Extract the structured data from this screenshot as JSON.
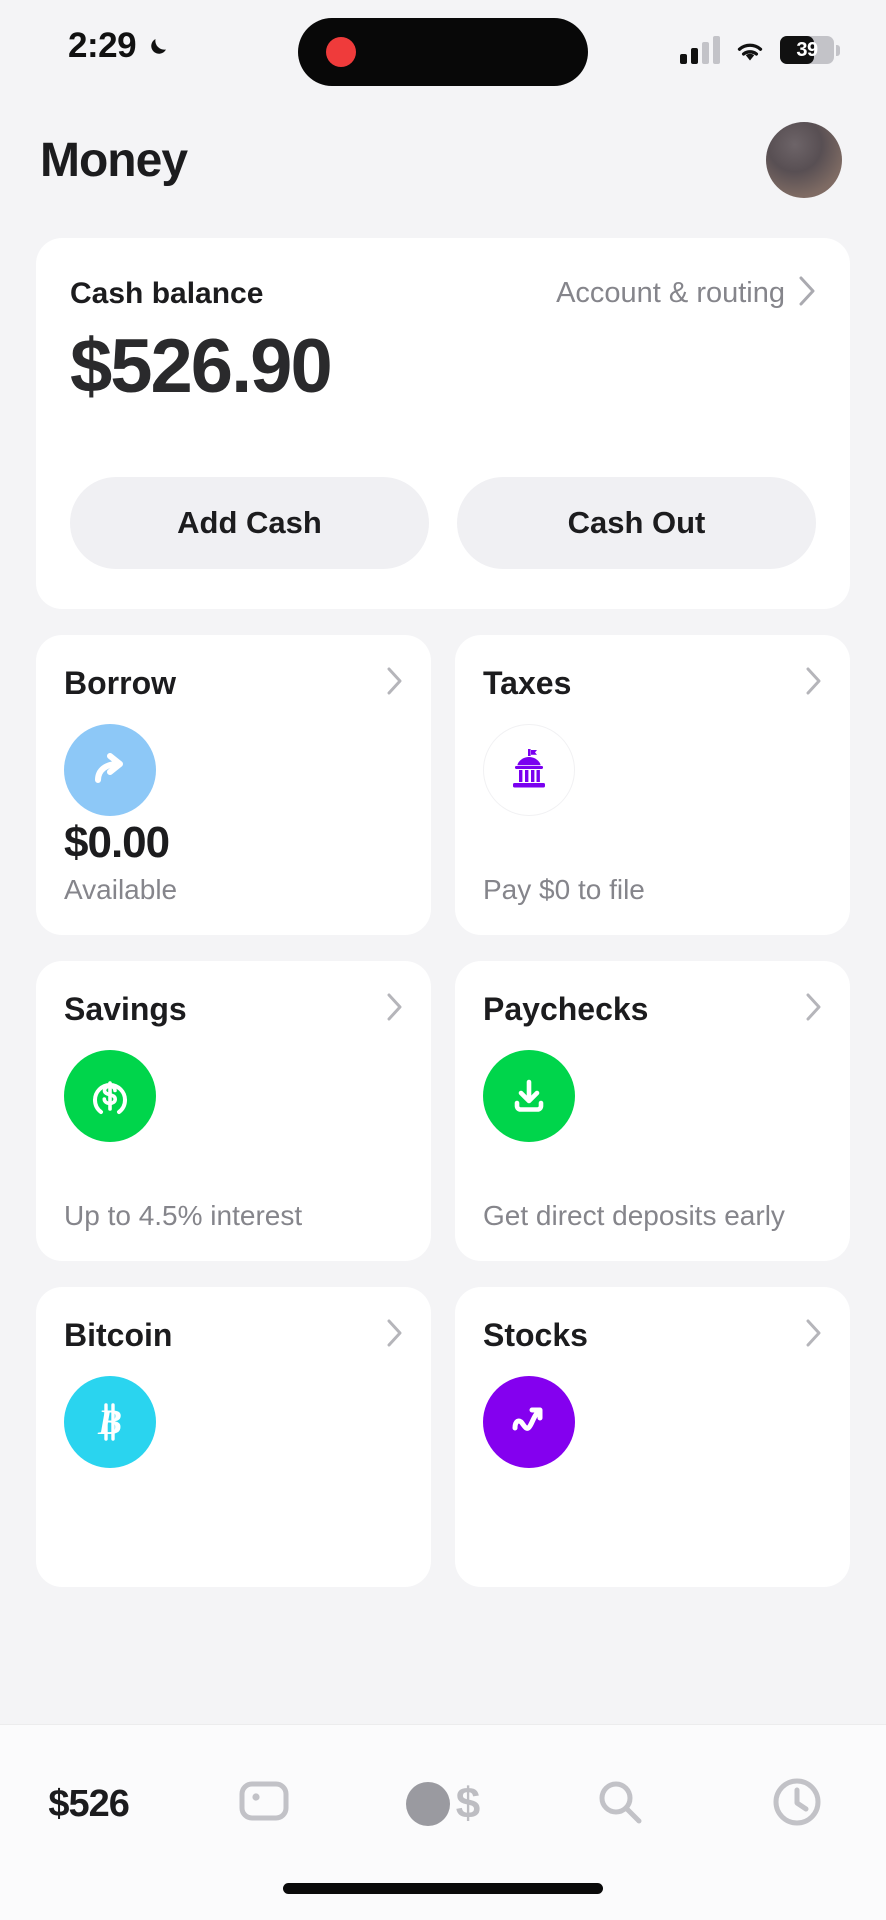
{
  "status_bar": {
    "time": "2:29",
    "dnd_icon": "moon-icon",
    "recording_icon": "record-dot-icon",
    "signal_icon": "cellular-signal-icon",
    "wifi_icon": "wifi-icon",
    "battery_level": "39",
    "battery_icon": "battery-icon"
  },
  "header": {
    "title": "Money",
    "avatar_icon": "profile-avatar"
  },
  "balance_card": {
    "label": "Cash balance",
    "account_routing_label": "Account & routing",
    "chevron_icon": "chevron-right-icon",
    "amount": "$526.90",
    "add_cash_label": "Add Cash",
    "cash_out_label": "Cash Out"
  },
  "tiles": [
    {
      "title": "Borrow",
      "icon": "borrow-arrow-icon",
      "icon_color": "#8dc8f7",
      "value": "$0.00",
      "subtitle": "Available",
      "chevron_icon": "chevron-right-icon"
    },
    {
      "title": "Taxes",
      "icon": "government-building-icon",
      "icon_color": "#8400ef",
      "value": "",
      "subtitle": "Pay $0 to file",
      "chevron_icon": "chevron-right-icon"
    },
    {
      "title": "Savings",
      "icon": "savings-dollar-icon",
      "icon_color": "#00d54b",
      "value": "",
      "subtitle": "Up to 4.5% interest",
      "chevron_icon": "chevron-right-icon"
    },
    {
      "title": "Paychecks",
      "icon": "direct-deposit-download-icon",
      "icon_color": "#00d54b",
      "value": "",
      "subtitle": "Get direct deposits early",
      "chevron_icon": "chevron-right-icon"
    },
    {
      "title": "Bitcoin",
      "icon": "bitcoin-icon",
      "icon_color": "#2ad4ef",
      "value": "",
      "subtitle": "",
      "chevron_icon": "chevron-right-icon"
    },
    {
      "title": "Stocks",
      "icon": "stocks-trending-up-icon",
      "icon_color": "#8400ef",
      "value": "",
      "subtitle": "",
      "chevron_icon": "chevron-right-icon"
    }
  ],
  "tab_bar": {
    "money_label": "$526",
    "card_icon": "card-icon",
    "pay_icon": "pay-dollar-icon",
    "search_icon": "search-icon",
    "activity_icon": "clock-activity-icon"
  }
}
